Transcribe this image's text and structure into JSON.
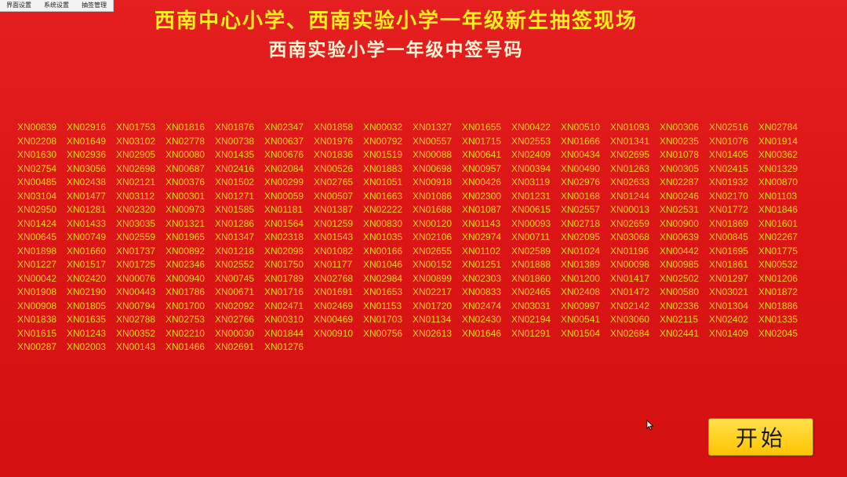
{
  "menu": {
    "items": [
      "界面设置",
      "系统设置",
      "抽签管理"
    ]
  },
  "header": {
    "title": "西南中心小学、西南实验小学一年级新生抽签现场",
    "subtitle": "西南实验小学一年级中签号码"
  },
  "codes": [
    "XN00839",
    "XN02916",
    "XN01753",
    "XN01816",
    "XN01876",
    "XN02347",
    "XN01858",
    "XN00032",
    "XN01327",
    "XN01655",
    "XN00422",
    "XN00510",
    "XN01093",
    "XN00306",
    "XN02516",
    "XN02784",
    "XN02208",
    "XN01649",
    "XN03102",
    "XN02778",
    "XN00738",
    "XN00637",
    "XN01976",
    "XN00792",
    "XN00557",
    "XN01715",
    "XN02553",
    "XN01666",
    "XN01341",
    "XN00235",
    "XN01076",
    "XN01914",
    "XN01630",
    "XN02936",
    "XN02905",
    "XN00080",
    "XN01435",
    "XN00676",
    "XN01836",
    "XN01519",
    "XN00088",
    "XN00641",
    "XN02409",
    "XN00434",
    "XN02695",
    "XN01078",
    "XN01405",
    "XN00362",
    "XN02754",
    "XN03056",
    "XN02698",
    "XN00687",
    "XN02416",
    "XN02084",
    "XN00526",
    "XN01883",
    "XN00698",
    "XN00957",
    "XN00394",
    "XN00490",
    "XN01263",
    "XN00305",
    "XN02415",
    "XN01329",
    "XN00485",
    "XN02438",
    "XN02121",
    "XN00376",
    "XN01502",
    "XN00299",
    "XN02765",
    "XN01051",
    "XN00918",
    "XN00426",
    "XN03119",
    "XN02976",
    "XN02633",
    "XN02287",
    "XN01932",
    "XN00870",
    "XN03104",
    "XN01477",
    "XN03112",
    "XN00301",
    "XN01271",
    "XN00059",
    "XN00507",
    "XN01663",
    "XN01086",
    "XN02300",
    "XN01231",
    "XN00168",
    "XN01244",
    "XN00246",
    "XN02170",
    "XN01103",
    "XN02950",
    "XN01281",
    "XN02320",
    "XN00973",
    "XN01585",
    "XN01181",
    "XN01387",
    "XN02222",
    "XN01688",
    "XN01087",
    "XN00615",
    "XN02557",
    "XN00013",
    "XN02531",
    "XN01772",
    "XN01846",
    "XN01424",
    "XN01433",
    "XN03035",
    "XN01321",
    "XN01286",
    "XN01564",
    "XN01259",
    "XN00830",
    "XN00120",
    "XN01143",
    "XN00093",
    "XN02718",
    "XN02659",
    "XN00900",
    "XN01869",
    "XN01601",
    "XN00645",
    "XN00749",
    "XN02559",
    "XN01965",
    "XN01347",
    "XN02318",
    "XN01543",
    "XN01035",
    "XN02106",
    "XN02974",
    "XN00711",
    "XN02095",
    "XN03068",
    "XN00639",
    "XN00845",
    "XN02267",
    "XN01898",
    "XN01660",
    "XN01737",
    "XN00892",
    "XN01218",
    "XN02098",
    "XN01082",
    "XN00166",
    "XN02655",
    "XN01102",
    "XN02589",
    "XN01024",
    "XN01196",
    "XN00442",
    "XN01695",
    "XN01775",
    "XN01227",
    "XN01517",
    "XN01725",
    "XN02346",
    "XN02552",
    "XN01750",
    "XN01177",
    "XN01046",
    "XN00152",
    "XN01251",
    "XN01888",
    "XN01389",
    "XN00098",
    "XN00985",
    "XN01861",
    "XN00532",
    "XN00042",
    "XN02420",
    "XN00076",
    "XN00940",
    "XN00745",
    "XN01789",
    "XN02768",
    "XN02984",
    "XN00899",
    "XN02303",
    "XN01860",
    "XN01200",
    "XN01417",
    "XN02502",
    "XN01297",
    "XN01206",
    "XN01908",
    "XN02190",
    "XN00443",
    "XN01786",
    "XN00671",
    "XN01716",
    "XN01691",
    "XN01653",
    "XN02217",
    "XN00833",
    "XN02465",
    "XN02408",
    "XN01472",
    "XN00580",
    "XN03021",
    "XN01872",
    "XN00908",
    "XN01805",
    "XN00794",
    "XN01700",
    "XN02092",
    "XN02471",
    "XN02469",
    "XN01153",
    "XN01720",
    "XN02474",
    "XN03031",
    "XN00997",
    "XN02142",
    "XN02336",
    "XN01304",
    "XN01886",
    "XN01838",
    "XN01635",
    "XN02788",
    "XN02753",
    "XN02766",
    "XN00310",
    "XN00469",
    "XN01703",
    "XN01134",
    "XN02430",
    "XN02194",
    "XN00541",
    "XN03060",
    "XN02115",
    "XN02402",
    "XN01335",
    "XN01615",
    "XN01243",
    "XN00352",
    "XN02210",
    "XN00030",
    "XN01844",
    "XN00910",
    "XN00756",
    "XN02613",
    "XN01646",
    "XN01291",
    "XN01504",
    "XN02684",
    "XN02441",
    "XN01409",
    "XN02045",
    "XN00287",
    "XN02003",
    "XN00143",
    "XN01466",
    "XN02691",
    "XN01276"
  ],
  "start_button": {
    "label": "开始"
  },
  "colors": {
    "background": "#dc1616",
    "title": "#ffef1a",
    "subtitle": "#fff3d6",
    "codes": "#ffd21a",
    "button": "#ffd000"
  }
}
